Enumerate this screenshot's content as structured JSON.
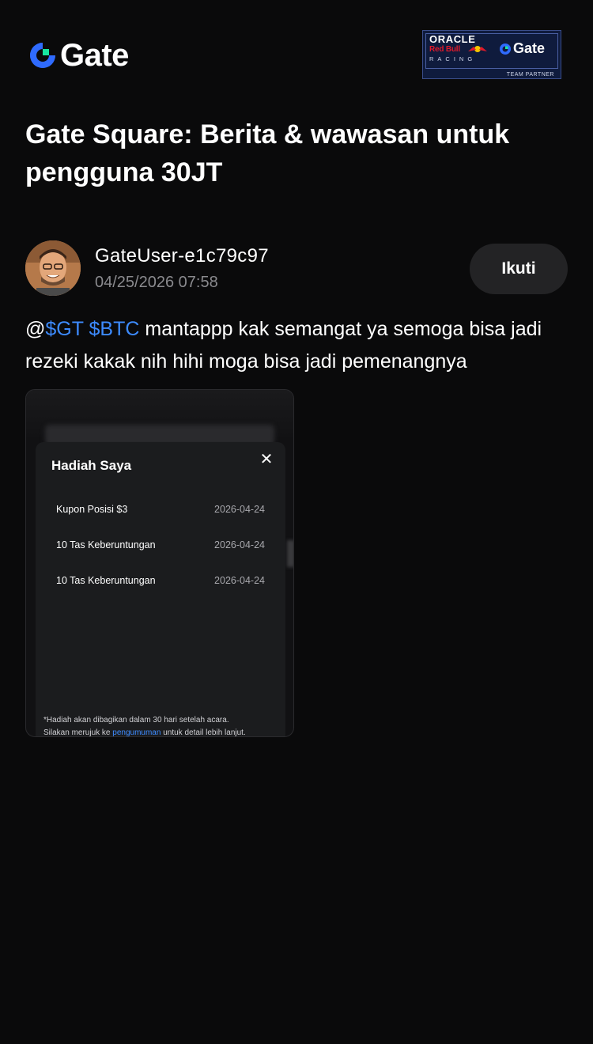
{
  "header": {
    "logo_text": "Gate",
    "partner": {
      "line1": "ORACLE",
      "line2": "Red Bull",
      "line3": "RACING",
      "brand": "Gate",
      "badge": "TEAM PARTNER"
    }
  },
  "title": "Gate Square: Berita & wawasan untuk pengguna 30JT",
  "author": {
    "username": "GateUser-e1c79c97",
    "timestamp": "04/25/2026 07:58",
    "follow_label": "Ikuti"
  },
  "post": {
    "at": "@",
    "tags": [
      "$GT",
      "$BTC"
    ],
    "text": " mantappp kak semangat ya semoga bisa jadi rezeki kakak nih hihi moga bisa jadi pemenangnya"
  },
  "screenshot": {
    "modal_title": "Hadiah Saya",
    "close_glyph": "✕",
    "rewards": [
      {
        "name": "Kupon Posisi $3",
        "date": "2026-04-24"
      },
      {
        "name": "10 Tas Keberuntungan",
        "date": "2026-04-24"
      },
      {
        "name": "10 Tas Keberuntungan",
        "date": "2026-04-24"
      }
    ],
    "note_line1": "*Hadiah akan dibagikan dalam 30 hari setelah acara.",
    "note_line2_a": "Silakan merujuk ke ",
    "note_link": "pengumuman",
    "note_line2_b": " untuk detail lebih lanjut."
  },
  "colors": {
    "background": "#0a0a0b",
    "accent_blue": "#3d8bff",
    "brand_green": "#17e6a1",
    "button_bg": "#232325"
  },
  "icons": [
    "gate-logo-icon",
    "close-icon",
    "avatar"
  ]
}
